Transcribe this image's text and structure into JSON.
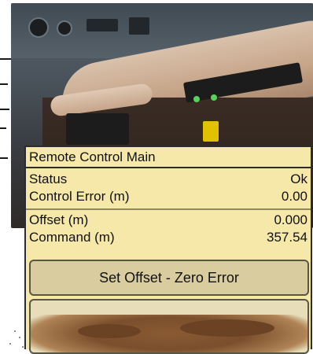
{
  "panel": {
    "title": "Remote Control Main",
    "rows": [
      {
        "label": "Status",
        "value": "Ok"
      },
      {
        "label": "Control Error (m)",
        "value": "0.00"
      },
      {
        "label": "Offset (m)",
        "value": "0.000"
      },
      {
        "label": "Command (m)",
        "value": "357.54"
      }
    ],
    "primary_button": "Set Offset - Zero Error"
  },
  "photo": {
    "description_icon": "joystick-console-photo"
  },
  "colors": {
    "panel_bg": "#f5e8a9",
    "button_bg": "#d9cda0",
    "border": "#2c2c2c"
  }
}
